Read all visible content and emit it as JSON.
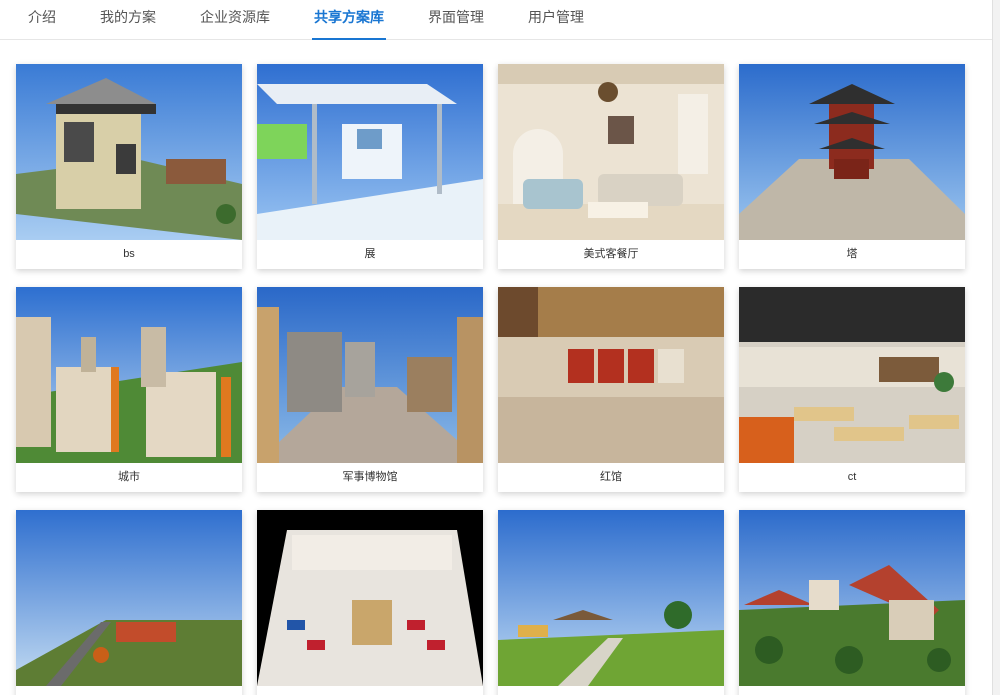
{
  "tabs": [
    {
      "label": "介绍",
      "active": false
    },
    {
      "label": "我的方案",
      "active": false
    },
    {
      "label": "企业资源库",
      "active": false
    },
    {
      "label": "共享方案库",
      "active": true
    },
    {
      "label": "界面管理",
      "active": false
    },
    {
      "label": "用户管理",
      "active": false
    }
  ],
  "accent_color": "#1976d2",
  "cards": [
    {
      "title": "bs",
      "thumb": "building-villa"
    },
    {
      "title": "展",
      "thumb": "exhibition-pavilion"
    },
    {
      "title": "美式客餐厅",
      "thumb": "american-living-room"
    },
    {
      "title": "塔",
      "thumb": "chinese-tower"
    },
    {
      "title": "城市",
      "thumb": "city-apartments"
    },
    {
      "title": "军事博物馆",
      "thumb": "military-museum"
    },
    {
      "title": "红馆",
      "thumb": "red-hall"
    },
    {
      "title": "ct",
      "thumb": "canteen"
    },
    {
      "title": "",
      "thumb": "field-aerial"
    },
    {
      "title": "",
      "thumb": "car-showroom"
    },
    {
      "title": "",
      "thumb": "park-pavilion"
    },
    {
      "title": "",
      "thumb": "village-houses"
    }
  ]
}
